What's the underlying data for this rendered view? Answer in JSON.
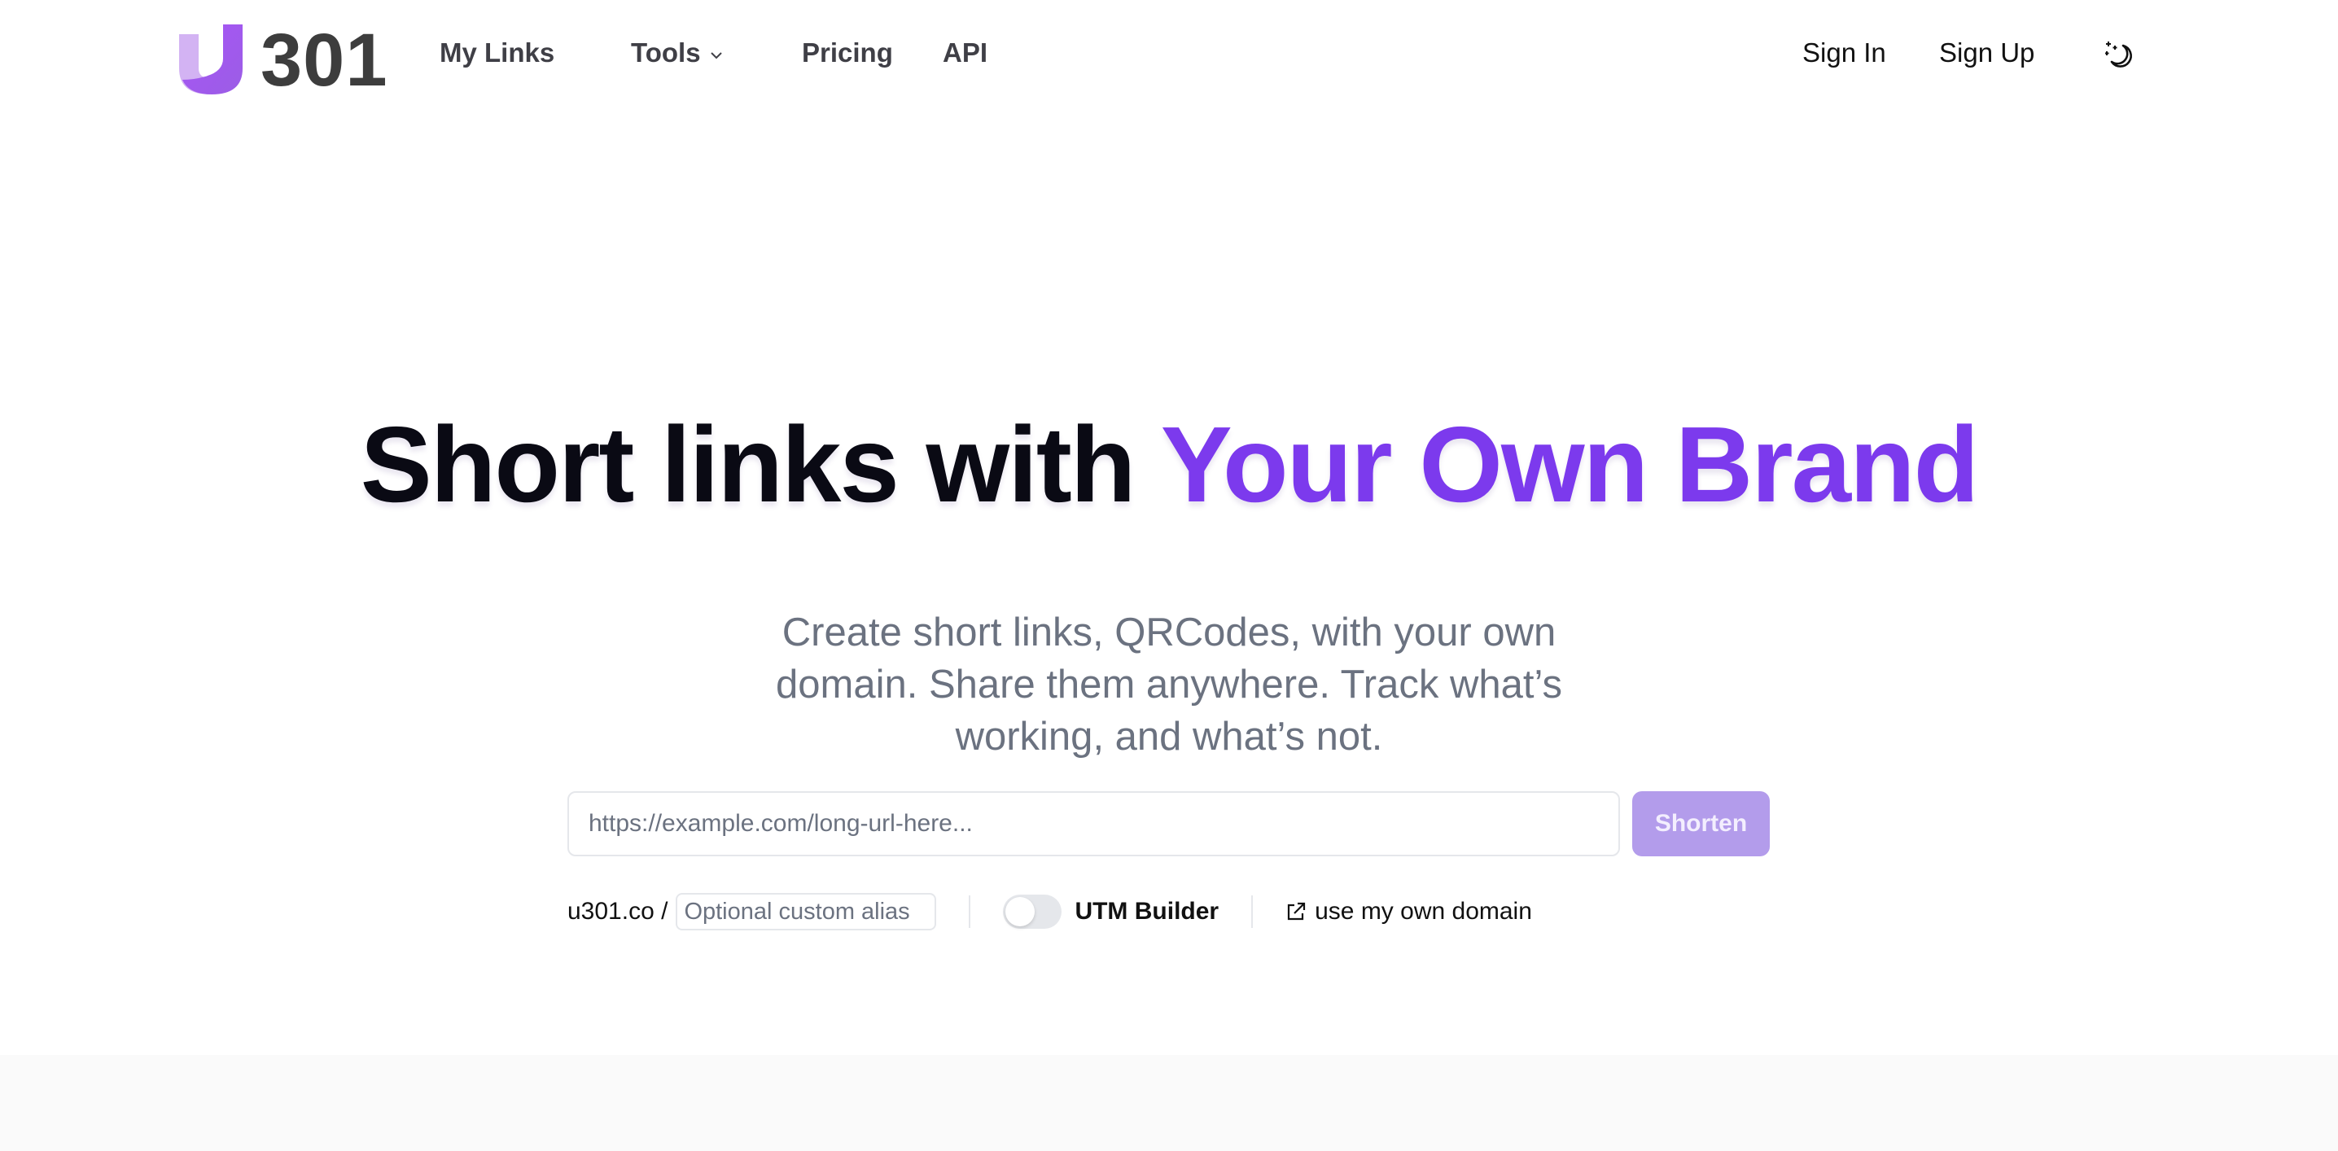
{
  "header": {
    "logo_text": "301",
    "nav": [
      {
        "label": "My Links"
      },
      {
        "label": "Tools",
        "has_dropdown": true
      },
      {
        "label": "Pricing"
      },
      {
        "label": "API"
      }
    ],
    "sign_in": "Sign In",
    "sign_up": "Sign Up",
    "theme_icon": "moon-stars-icon"
  },
  "hero": {
    "title_plain": "Short links with ",
    "title_accent": "Your Own Brand",
    "subtitle": "Create short links, QRCodes, with your own domain. Share them anywhere. Track what’s working, and what’s not."
  },
  "shortener": {
    "url_placeholder": "https://example.com/long-url-here...",
    "url_value": "",
    "button_label": "Shorten",
    "domain_prefix": "u301.co /",
    "alias_placeholder": "Optional custom alias",
    "alias_value": "",
    "utm_label": "UTM Builder",
    "utm_enabled": false,
    "own_domain_label": "use my own domain"
  },
  "colors": {
    "accent": "#7c3aed",
    "button_disabled": "#b39ceb",
    "logo_light": "#d3b3f3",
    "logo_dark": "#a855f7",
    "text_muted": "#6b7280"
  }
}
